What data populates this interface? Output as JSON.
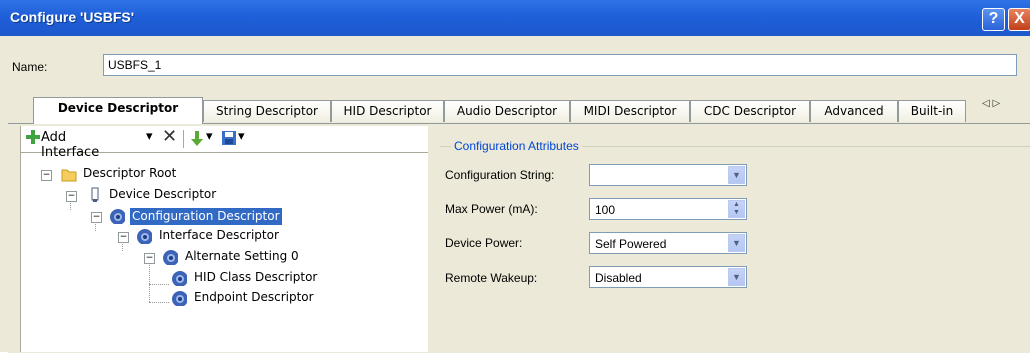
{
  "window": {
    "title": "Configure 'USBFS'",
    "help_glyph": "?",
    "close_glyph": "X"
  },
  "name": {
    "label": "Name:",
    "value": "USBFS_1"
  },
  "tabs": [
    {
      "label": "Device Descriptor",
      "active": true
    },
    {
      "label": "String Descriptor"
    },
    {
      "label": "HID Descriptor"
    },
    {
      "label": "Audio Descriptor"
    },
    {
      "label": "MIDI Descriptor"
    },
    {
      "label": "CDC Descriptor"
    },
    {
      "label": "Advanced"
    },
    {
      "label": "Built-in"
    }
  ],
  "tab_scroll": "◁ ▷",
  "toolbar": {
    "add_interface": "Add Interface",
    "dropdown_glyph": "▾",
    "delete_glyph": "✕"
  },
  "tree": [
    {
      "label": "Descriptor Root",
      "icon": "folder-icon"
    },
    {
      "label": "Device Descriptor",
      "icon": "usb-plug-icon"
    },
    {
      "label": "Configuration Descriptor",
      "icon": "gear-icon",
      "selected": true
    },
    {
      "label": "Interface Descriptor",
      "icon": "gear-icon"
    },
    {
      "label": "Alternate Setting 0",
      "icon": "gear-icon"
    },
    {
      "label": "HID Class Descriptor",
      "icon": "gear-icon"
    },
    {
      "label": "Endpoint Descriptor",
      "icon": "gear-icon"
    }
  ],
  "attributes": {
    "group_title": "Configuration Attributes",
    "fields": [
      {
        "label": "Configuration String:",
        "value": "",
        "control": "dropdown"
      },
      {
        "label": "Max Power (mA):",
        "value": "100",
        "control": "spinner"
      },
      {
        "label": "Device Power:",
        "value": "Self Powered",
        "control": "dropdown"
      },
      {
        "label": "Remote Wakeup:",
        "value": "Disabled",
        "control": "dropdown"
      }
    ]
  },
  "colors": {
    "titlebar": "#1f5fd9",
    "selection": "#316ac5",
    "group_title": "#0046d5",
    "dialog_bg": "#ece9d8"
  }
}
